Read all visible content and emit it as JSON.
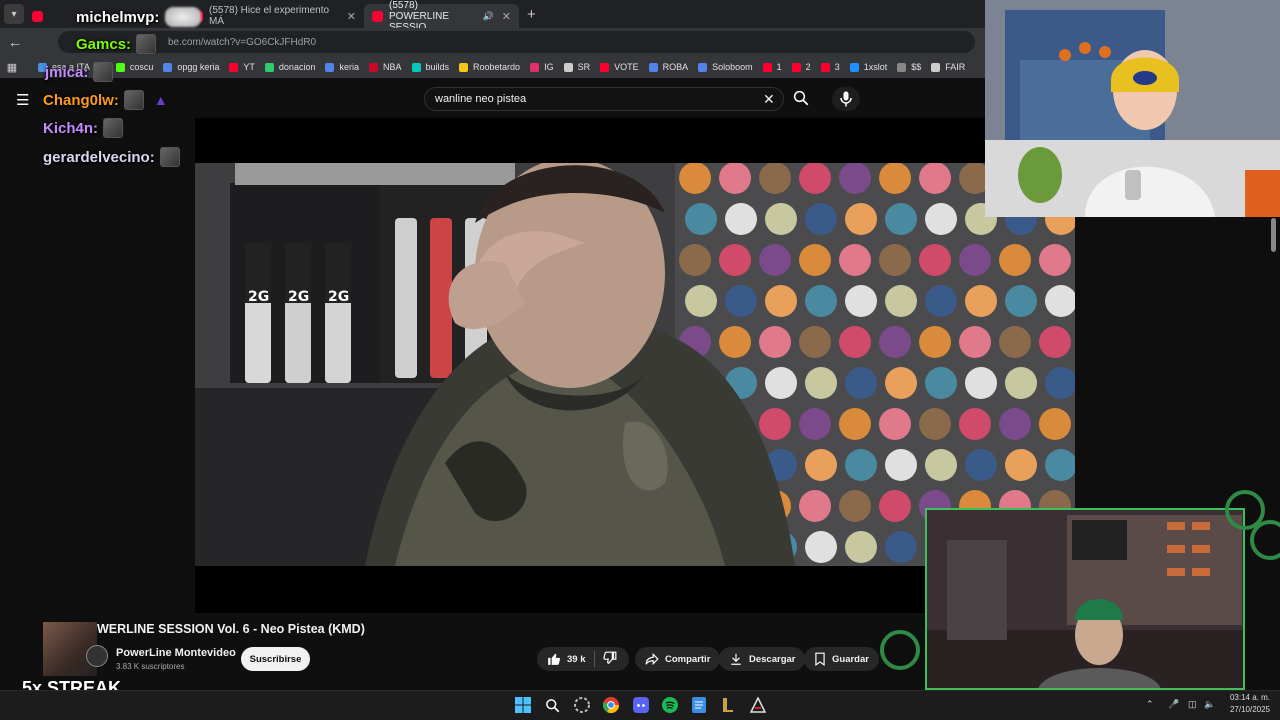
{
  "browser": {
    "tabs": [
      {
        "label": "",
        "active": false
      },
      {
        "label": "(5578) Hice el experimento MÁ",
        "active": false
      },
      {
        "label": "(5578) POWERLINE SESSIO",
        "active": true
      }
    ],
    "url": "be.com/watch?v=GO6CkJFHdR0",
    "bookmarks": [
      {
        "label": "esa a ITA",
        "color": "#4a90e2"
      },
      {
        "label": "coscu",
        "color": "#53fc18"
      },
      {
        "label": "opgg keria",
        "color": "#5383e8"
      },
      {
        "label": "YT",
        "color": "#ff0033"
      },
      {
        "label": "donacion",
        "color": "#2ecc71"
      },
      {
        "label": "keria",
        "color": "#5383e8"
      },
      {
        "label": "NBA",
        "color": "#c9082a"
      },
      {
        "label": "builds",
        "color": "#0ac8b9"
      },
      {
        "label": "Roobetardo",
        "color": "#f5c518"
      },
      {
        "label": "IG",
        "color": "#e1306c"
      },
      {
        "label": "SR",
        "color": "#cccccc"
      },
      {
        "label": "VOTE",
        "color": "#ff0033"
      },
      {
        "label": "ROBA",
        "color": "#5383e8"
      },
      {
        "label": "Soloboom",
        "color": "#5383e8"
      },
      {
        "label": "1",
        "color": "#ff0033"
      },
      {
        "label": "2",
        "color": "#ff0033"
      },
      {
        "label": "3",
        "color": "#ff0033"
      },
      {
        "label": "1xslot",
        "color": "#1e90ff"
      },
      {
        "label": "$$",
        "color": "#888888"
      },
      {
        "label": "FAIR",
        "color": "#cccccc"
      }
    ]
  },
  "chat": [
    {
      "name": "michelmvp:",
      "color": "#ffffff"
    },
    {
      "name": "Gamcs:",
      "color": "#7cfc00"
    },
    {
      "name": "jmica:",
      "color": "#c58cff"
    },
    {
      "name": "Chang0lw:",
      "color": "#ff9a1f"
    },
    {
      "name": "Kich4n:",
      "color": "#c58cff"
    },
    {
      "name": "gerardelvecino:",
      "color": "#d8d8f0"
    }
  ],
  "youtube": {
    "search_value": "wanline neo pistea",
    "video_title": "WERLINE SESSION Vol. 6 - Neo Pistea (KMD)",
    "channel_name": "PowerLine Montevideo",
    "channel_subs": "3.83 K suscriptores",
    "subscribe_label": "Suscribirse",
    "likes": "39 k",
    "share_label": "Compartir",
    "download_label": "Descargar",
    "save_label": "Guardar"
  },
  "overlay": {
    "streak": "5x STREAK"
  },
  "taskbar": {
    "time": "03:14 a. m.",
    "date": "27/10/2025"
  }
}
